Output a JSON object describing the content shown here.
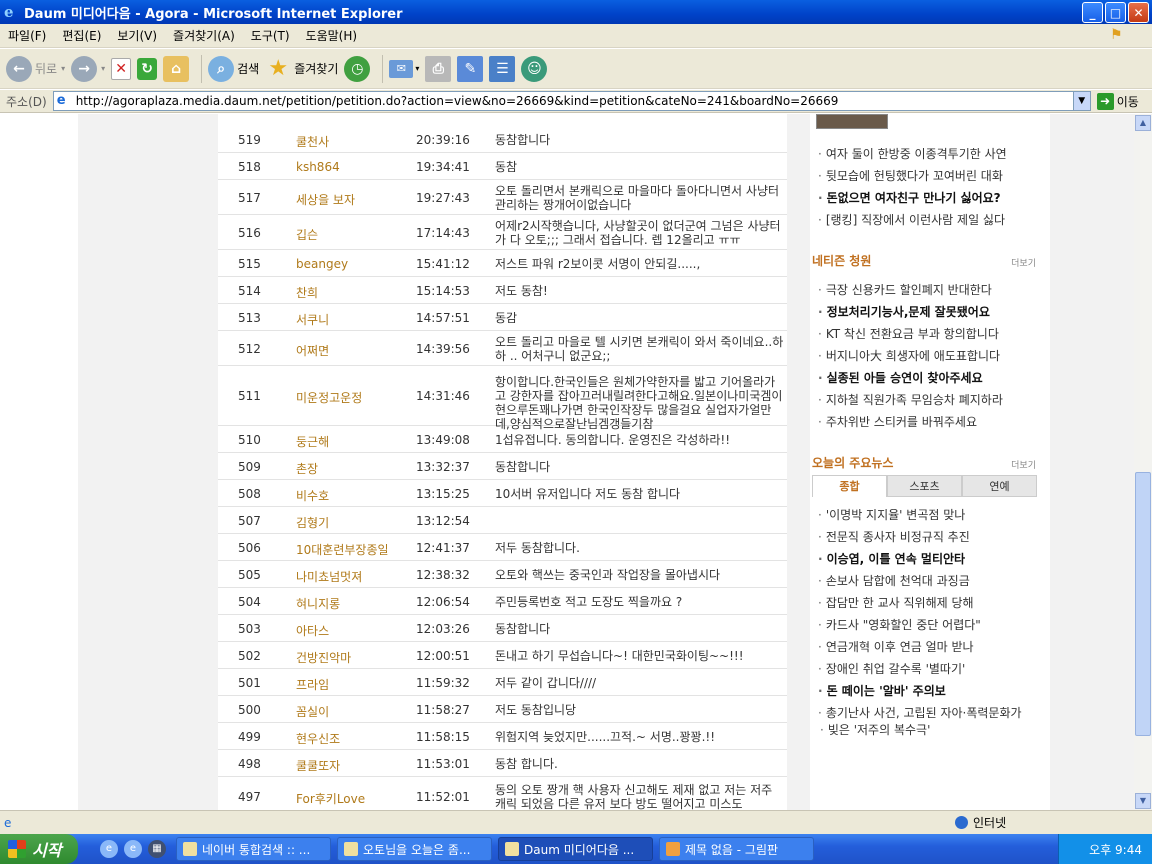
{
  "window": {
    "title": "Daum 미디어다음 - Agora - Microsoft Internet Explorer"
  },
  "menu": [
    "파일(F)",
    "편집(E)",
    "보기(V)",
    "즐겨찾기(A)",
    "도구(T)",
    "도움말(H)"
  ],
  "toolbar": {
    "back": "뒤로",
    "search": "검색",
    "favorites": "즐겨찾기"
  },
  "address": {
    "label": "주소(D)",
    "url": "http://agoraplaza.media.daum.net/petition/petition.do?action=view&no=26669&kind=petition&cateNo=241&boardNo=26669",
    "go": "이동"
  },
  "rows": [
    {
      "no": "519",
      "nick": "쿨천사",
      "time": "20:39:16",
      "msg": "동참합니다"
    },
    {
      "no": "518",
      "nick": "ksh864",
      "time": "19:34:41",
      "msg": "동참"
    },
    {
      "no": "517",
      "nick": "세상을 보자",
      "time": "19:27:43",
      "msg": "오토 돌리면서 본캐릭으로 마을마다 돌아다니면서 사냥터관리하는 짱개어이없습니다"
    },
    {
      "no": "516",
      "nick": "깁슨",
      "time": "17:14:43",
      "msg": "어제r2시작햇습니다, 사냥할곳이 없더군여 그넘은 사냥터가 다 오토;;; 그래서 접습니다. 렙 12올리고 ㅠㅠ"
    },
    {
      "no": "515",
      "nick": "beangey",
      "time": "15:41:12",
      "msg": "저스트 파워 r2보이콧 서명이 안되길.....,"
    },
    {
      "no": "514",
      "nick": "찬희",
      "time": "15:14:53",
      "msg": "저도 동참!"
    },
    {
      "no": "513",
      "nick": "서쿠니",
      "time": "14:57:51",
      "msg": "동감"
    },
    {
      "no": "512",
      "nick": "어쩌면",
      "time": "14:39:56",
      "msg": "오트 돌리고 마을로 텔 시키면 본캐릭이 와서 죽이네요..하하 .. 어처구니 없군요;;"
    },
    {
      "no": "511",
      "nick": "미운정고운정",
      "time": "14:31:46",
      "msg": "항이합니다.한국인들은 원체가약한자를 밟고 기어올라가고 강한자를 잡아끄러내릴려한다고해요.일본이나미국겜이 현으루돈꽤나가면 한국인작장두 많을걸요 실업자가얼만데,양심적으로잘난님겜갱들기참"
    },
    {
      "no": "510",
      "nick": "둥근해",
      "time": "13:49:08",
      "msg": "1섭유접니다. 동의합니다. 운영진은 각성하라!!"
    },
    {
      "no": "509",
      "nick": "촌장",
      "time": "13:32:37",
      "msg": "동참합니다"
    },
    {
      "no": "508",
      "nick": "비수호",
      "time": "13:15:25",
      "msg": "10서버 유저입니다 저도 동참 합니다"
    },
    {
      "no": "507",
      "nick": "김형기",
      "time": "13:12:54",
      "msg": ""
    },
    {
      "no": "506",
      "nick": "10대훈련부장종일",
      "time": "12:41:37",
      "msg": "저두 동참합니다."
    },
    {
      "no": "505",
      "nick": "나미쵸넘멋져",
      "time": "12:38:32",
      "msg": "오토와 핵쓰는 중국인과 작업장을 몰아냅시다"
    },
    {
      "no": "504",
      "nick": "혀니지롱",
      "time": "12:06:54",
      "msg": "주민등록번호 적고 도장도 찍을까요 ?"
    },
    {
      "no": "503",
      "nick": "아타스",
      "time": "12:03:26",
      "msg": "동참합니다"
    },
    {
      "no": "502",
      "nick": "건방진악마",
      "time": "12:00:51",
      "msg": "돈내고 하기 무섭습니다~! 대한민국화이팅~~!!!"
    },
    {
      "no": "501",
      "nick": "프라임",
      "time": "11:59:32",
      "msg": "저두 같이 갑니다////"
    },
    {
      "no": "500",
      "nick": "꼼실이",
      "time": "11:58:27",
      "msg": "저도 동참입니당"
    },
    {
      "no": "499",
      "nick": "현우신조",
      "time": "11:58:15",
      "msg": "위험지역 늦었지만......끄적.~ 서명..꽝꽝.!!"
    },
    {
      "no": "498",
      "nick": "쿨쿨또자",
      "time": "11:53:01",
      "msg": "동참 합니다."
    },
    {
      "no": "497",
      "nick": "For후키Love",
      "time": "11:52:01",
      "msg": "동의 오토 짱개 핵 사용자 신고해도 제재 없고 저는 저주 캐릭 되었음 다른 유저 보다 방도 떨어지고 미스도"
    }
  ],
  "sidebar": {
    "top_items": [
      "여자 둘이 한방중 이종격투기한 사연",
      "뒷모습에 헌팅했다가 꼬여버린 대화",
      "돈없으면 여자친구 만나기 싫어요?",
      "[랭킹] 직장에서 이런사람 제일 싫다"
    ],
    "petition_title": "네티즌 청원",
    "more": "더보기",
    "petition_items": [
      "극장 신용카드 할인폐지 반대한다",
      "정보처리기능사,문제 잘못됐어요",
      "KT 착신 전환요금 부과 항의합니다",
      "버지니아大 희생자에 애도표합니다",
      "실종된 아들 승연이 찾아주세요",
      "지하철 직원가족 무임승차 폐지하라",
      "주차위반 스티커를 바꿔주세요"
    ],
    "news_title": "오늘의 주요뉴스",
    "tabs": [
      "종합",
      "스포츠",
      "연예"
    ],
    "news_items": [
      "'이명박 지지율' 변곡점 맞나",
      "전문직 종사자 비정규직 추진",
      "이승엽, 이틀 연속 멀티안타",
      "손보사 담합에 천억대 과징금",
      "잡담만 한 교사 직위해제 당해",
      "카드사 \"영화할인 중단 어렵다\"",
      "연금개혁 이후 연금 얼마 받나",
      "장애인 취업 갈수록 '별따기'",
      "돈 떼이는 '알바' 주의보",
      "총기난사 사건, 고립된 자아·폭력문화가",
      "빚은 '저주의 복수극'"
    ]
  },
  "status": {
    "zone": "인터넷"
  },
  "taskbar": {
    "start": "시작",
    "tasks": [
      "네이버 통합검색 :: ...",
      "오토님을 오늘은 좀...",
      "Daum 미디어다음 ...",
      "제목 없음 - 그림판"
    ],
    "clock": "오후 9:44"
  }
}
